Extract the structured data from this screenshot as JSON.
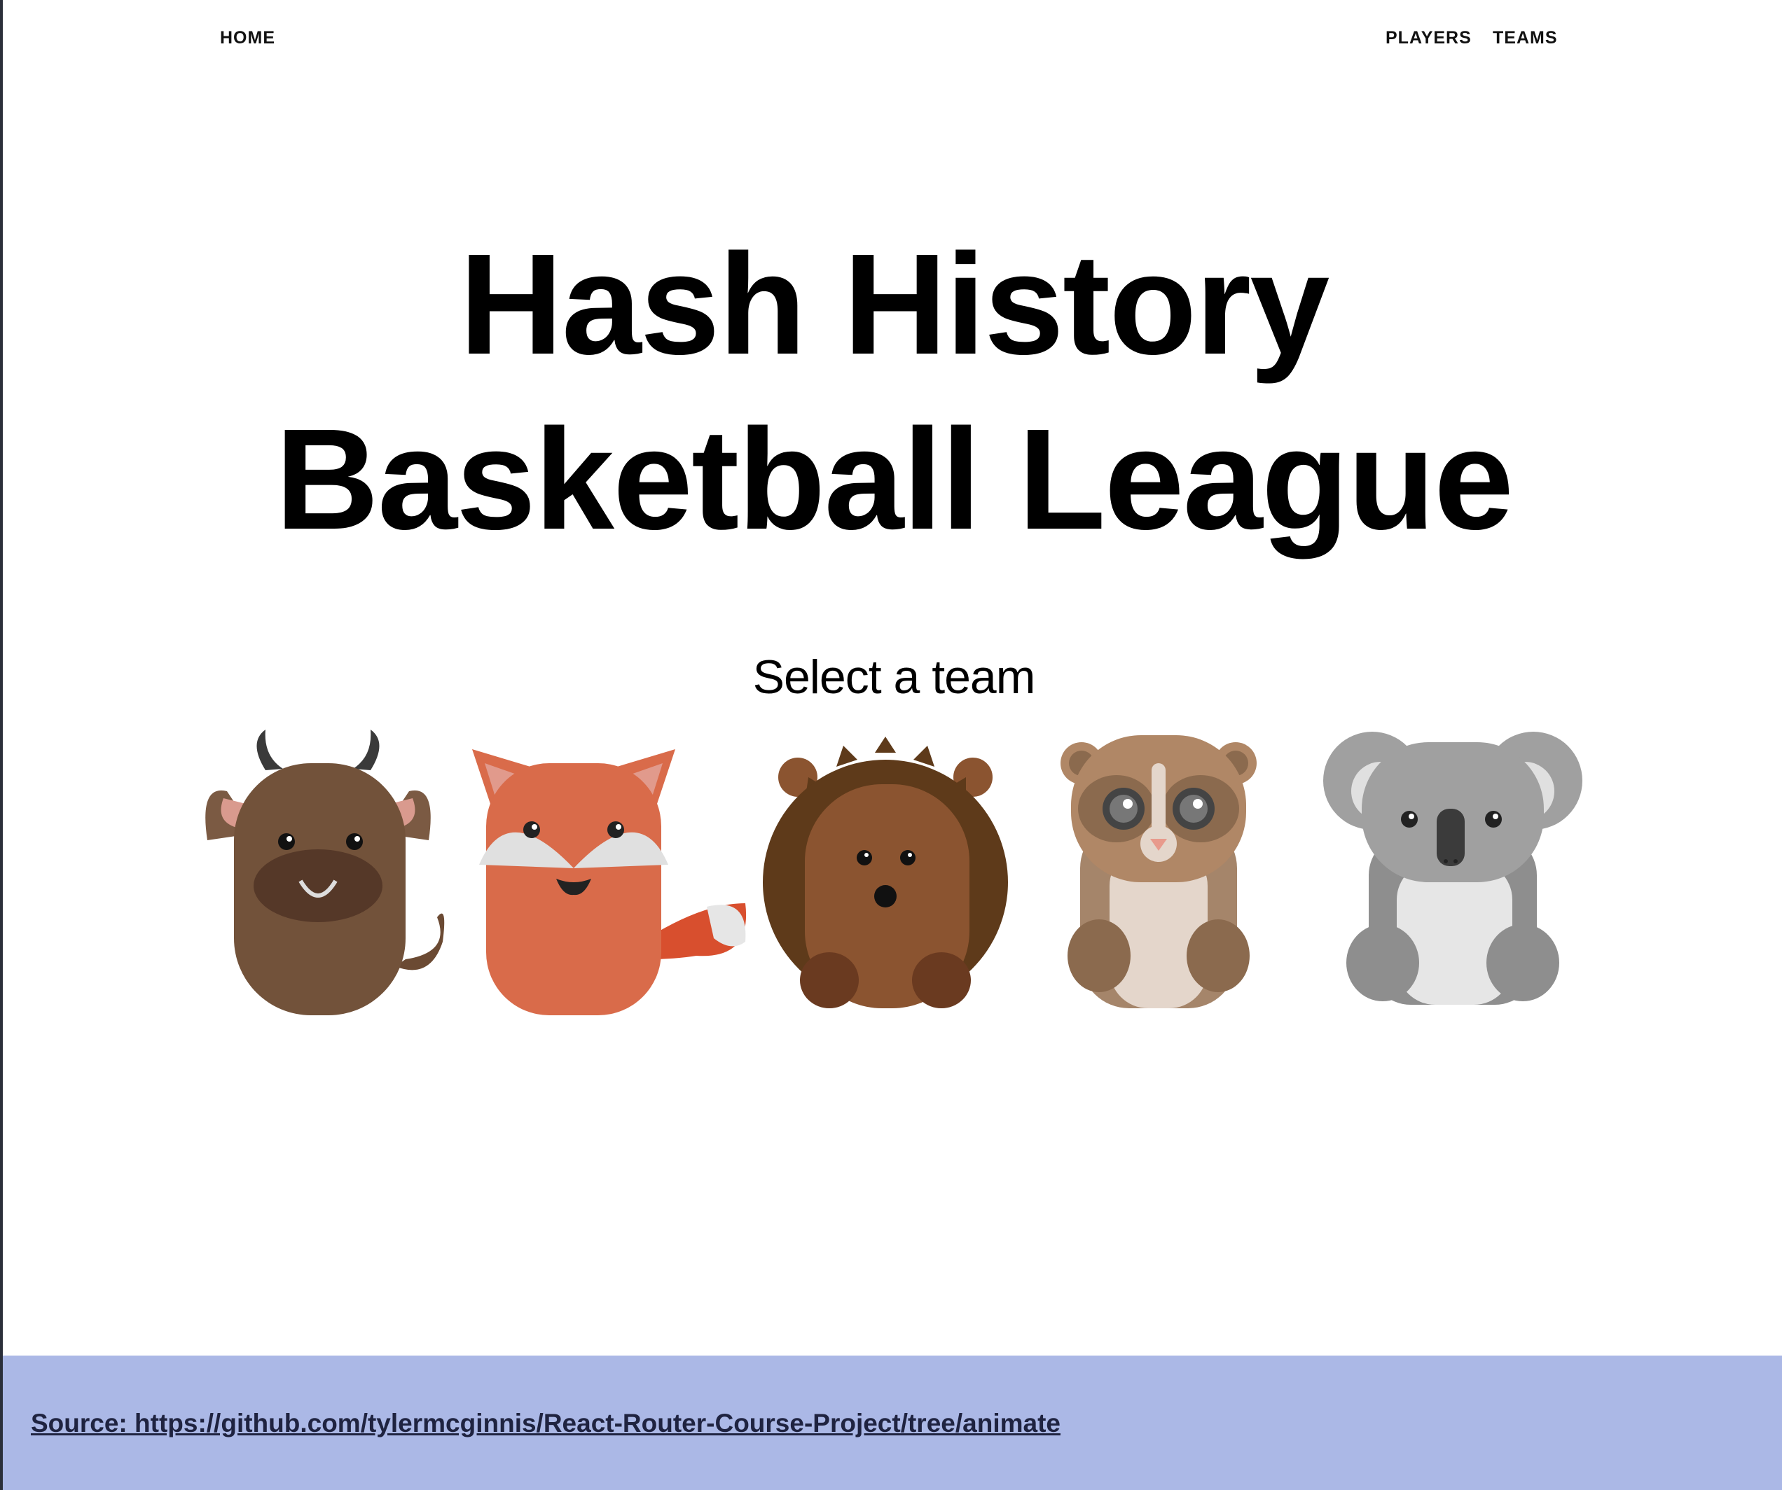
{
  "nav": {
    "home_label": "HOME",
    "players_label": "PLAYERS",
    "teams_label": "TEAMS"
  },
  "hero": {
    "title_line1": "Hash History",
    "title_line2": "Basketball League",
    "subtitle": "Select a team"
  },
  "teams": [
    {
      "icon": "bull-icon"
    },
    {
      "icon": "fox-icon"
    },
    {
      "icon": "hedgehog-icon"
    },
    {
      "icon": "lemur-icon"
    },
    {
      "icon": "koala-icon"
    }
  ],
  "footer": {
    "source_label": "Source: https://github.com/tylermcginnis/React-Router-Course-Project/tree/animate"
  },
  "colors": {
    "footer_background": "#abb8e6",
    "text": "#000000"
  }
}
